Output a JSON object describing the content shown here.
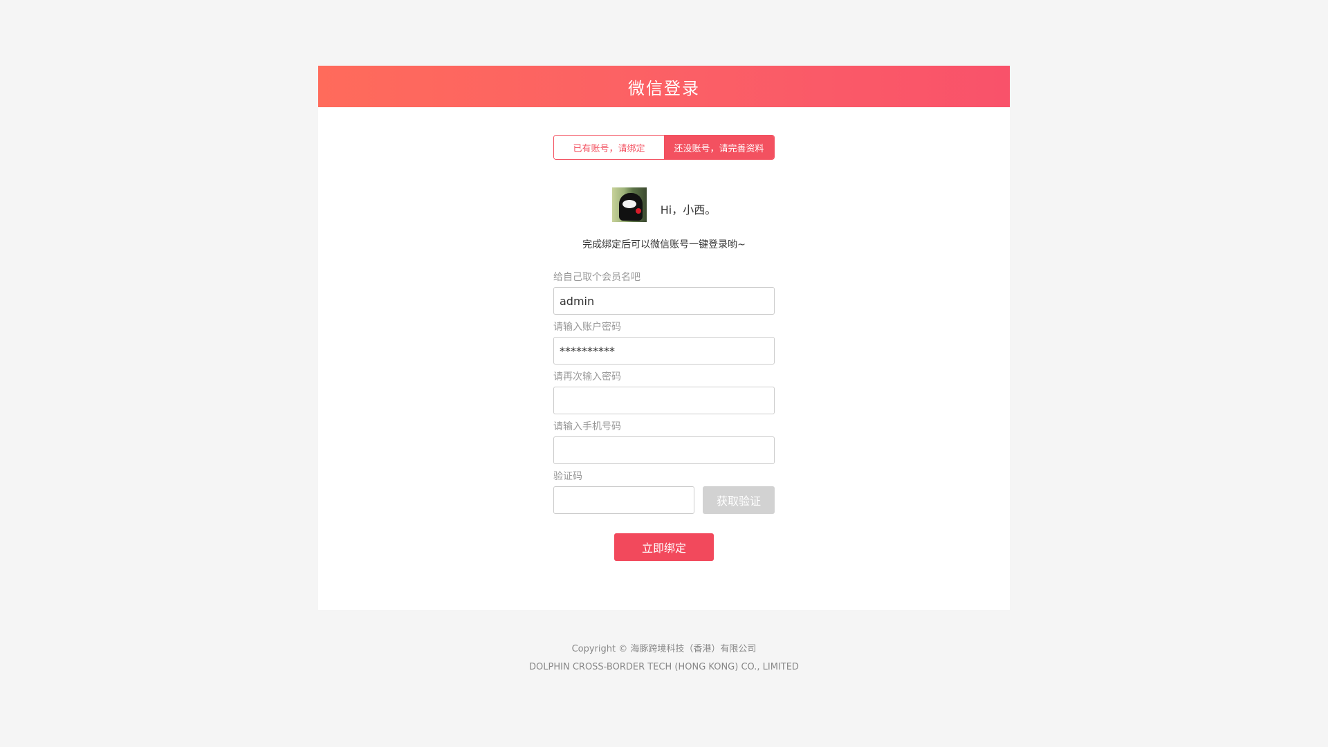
{
  "header": {
    "title": "微信登录"
  },
  "tabs": [
    {
      "label": "已有账号，请绑定",
      "active": false
    },
    {
      "label": "还没账号，请完善资料",
      "active": true
    }
  ],
  "profile": {
    "greeting": "Hi，小西。",
    "subtitle": "完成绑定后可以微信账号一键登录哟~"
  },
  "form": {
    "username": {
      "label": "给自己取个会员名吧",
      "value": "admin"
    },
    "password": {
      "label": "请输入账户密码",
      "value": "**********"
    },
    "confirm_password": {
      "label": "请再次输入密码",
      "value": ""
    },
    "phone": {
      "label": "请输入手机号码",
      "value": ""
    },
    "code": {
      "label": "验证码",
      "value": "",
      "button_label": "获取验证"
    },
    "submit_label": "立即绑定"
  },
  "footer": {
    "copyright": "Copyright ©  海豚跨境科技（香港）有限公司",
    "company_en": "DOLPHIN CROSS-BORDER TECH (HONG KONG) CO., LIMITED"
  },
  "colors": {
    "accent": "#f35160",
    "header_gradient_start": "#ff6b5b",
    "header_gradient_end": "#f9526a",
    "disabled_button": "#d2d2d2"
  }
}
